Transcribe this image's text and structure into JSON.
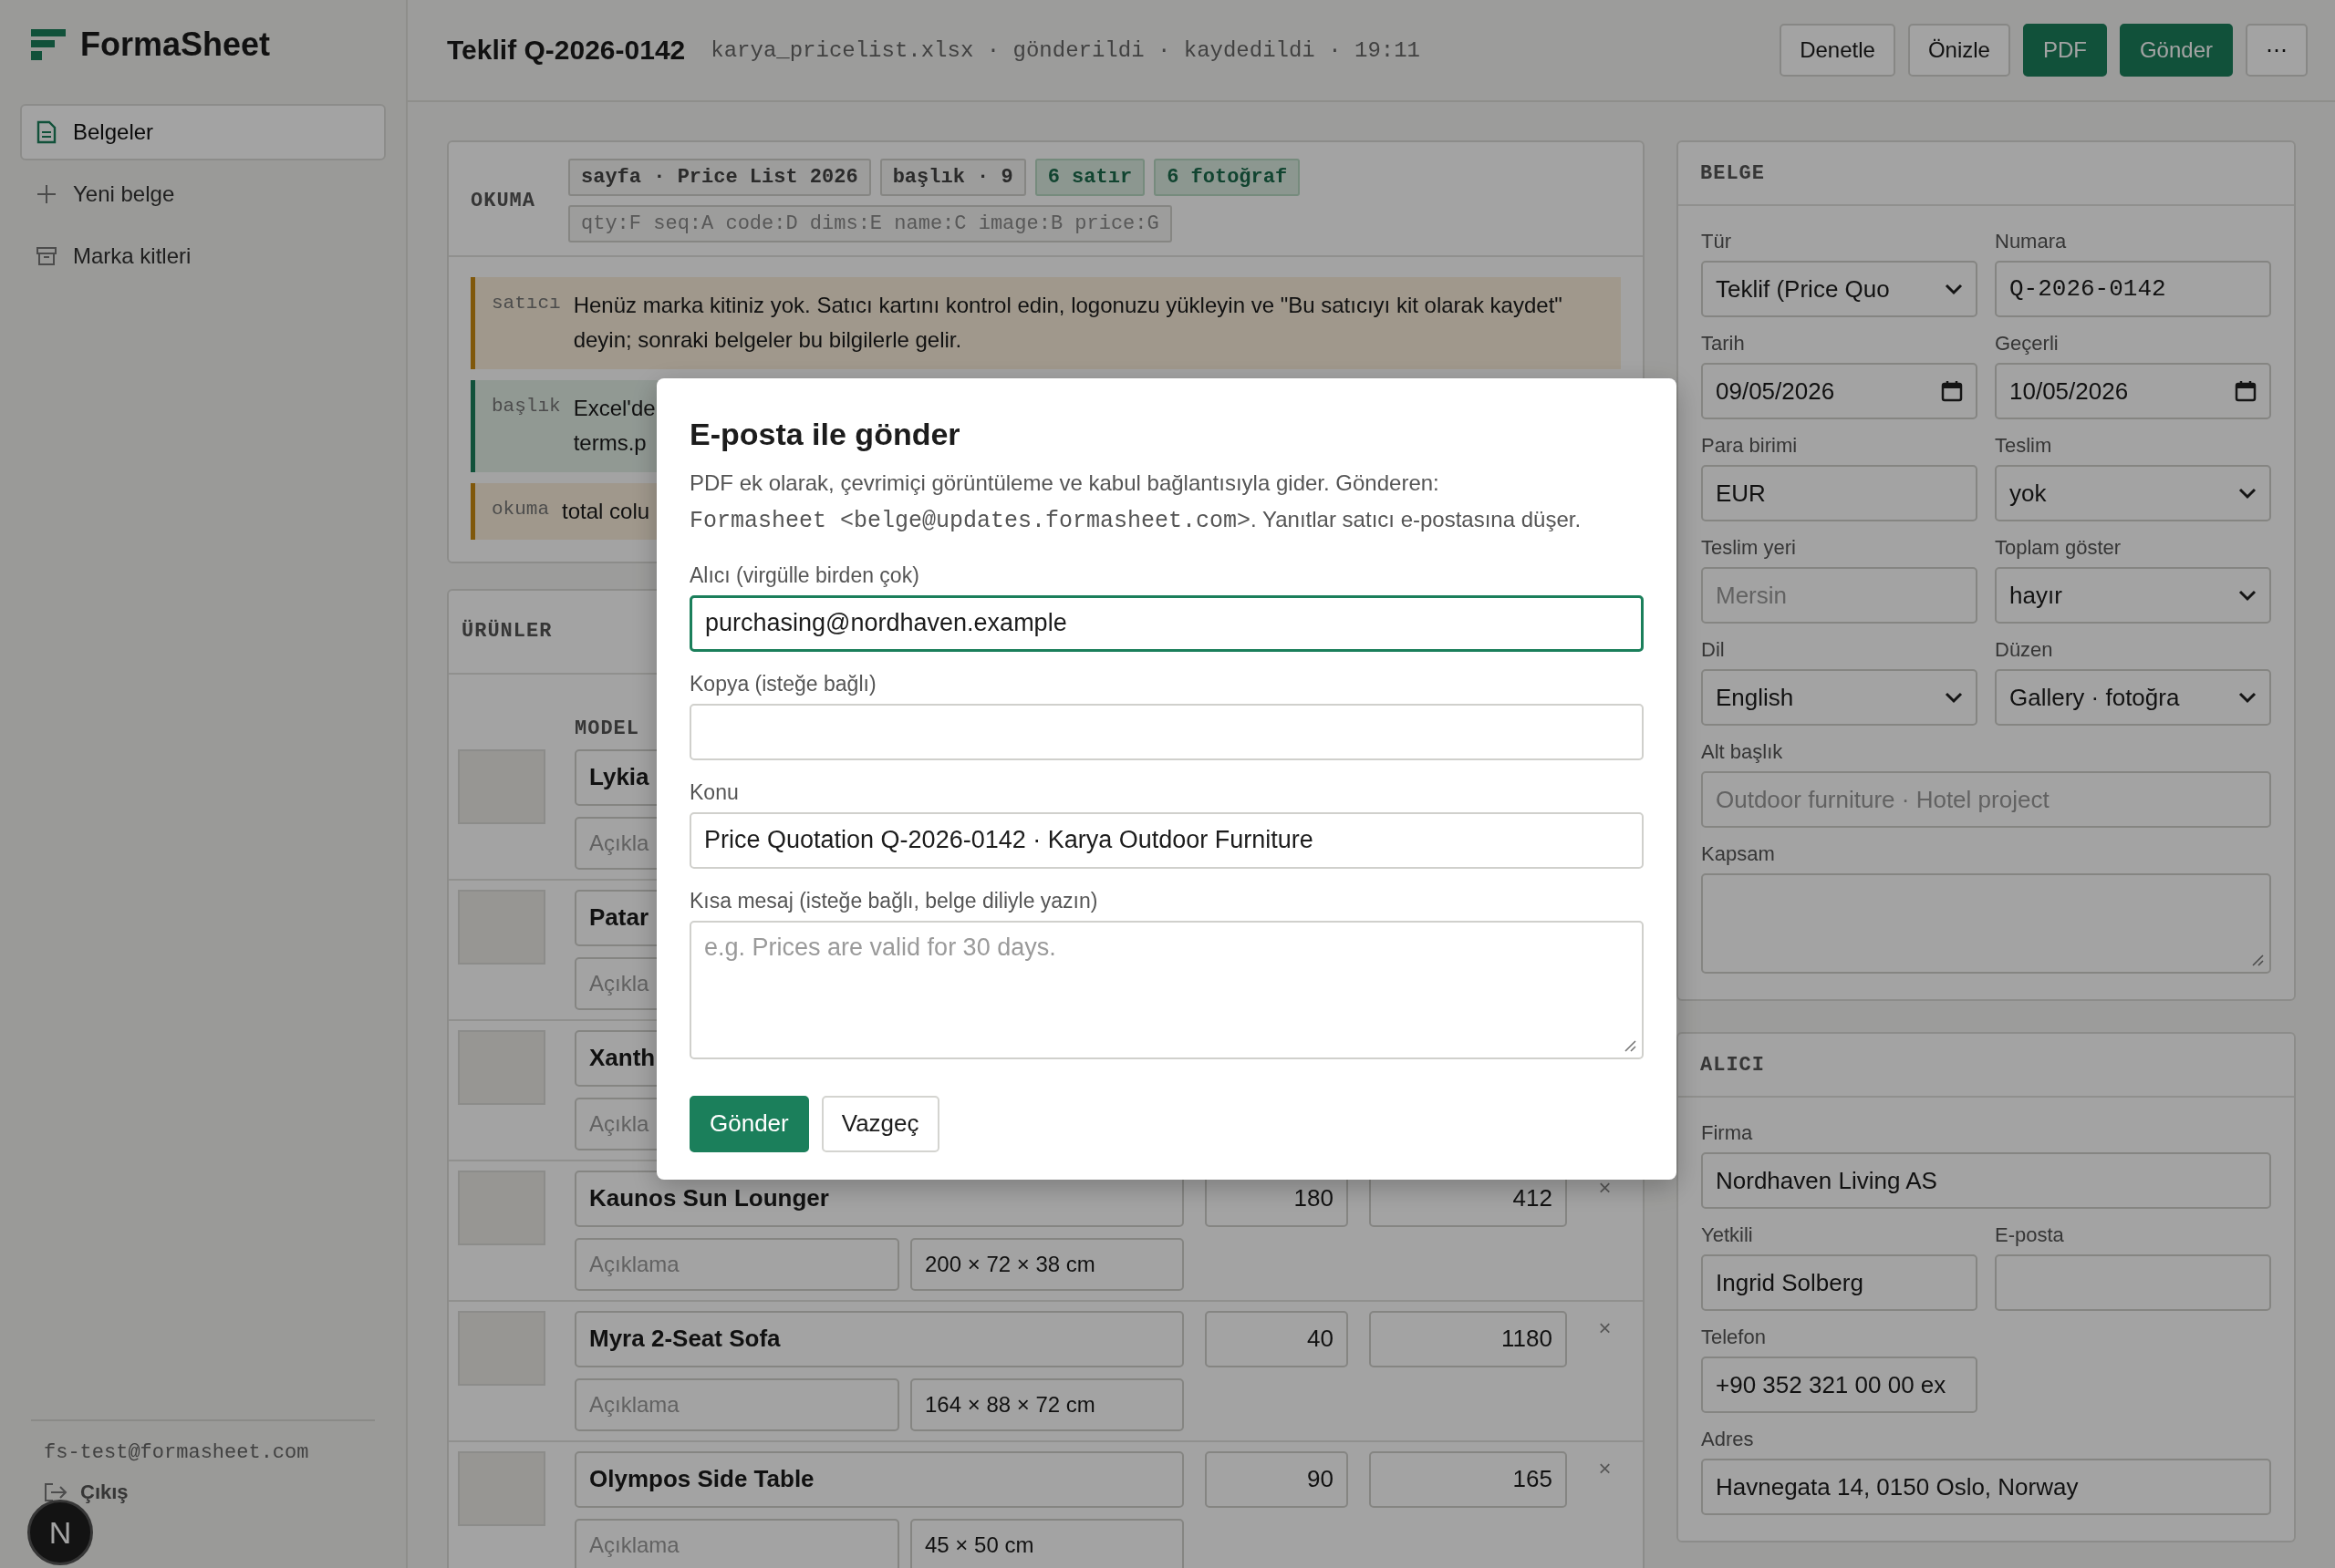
{
  "sidebar": {
    "brand": "FormaSheet",
    "items": [
      {
        "label": "Belgeler",
        "selected": true
      },
      {
        "label": "Yeni belge",
        "selected": false
      },
      {
        "label": "Marka kitleri",
        "selected": false
      }
    ],
    "user_email": "fs-test@formasheet.com",
    "logout": "Çıkış"
  },
  "header": {
    "title": "Teklif Q-2026-0142",
    "meta": "karya_pricelist.xlsx · gönderildi · kaydedildi · 19:11",
    "buttons": [
      {
        "label": "Denetle",
        "kind": "outline"
      },
      {
        "label": "Önizle",
        "kind": "outline"
      },
      {
        "label": "PDF",
        "kind": "primary"
      },
      {
        "label": "Gönder",
        "kind": "primary"
      },
      {
        "label": "⋯",
        "kind": "outline"
      }
    ]
  },
  "reading": {
    "title": "OKUMA",
    "chips": [
      {
        "label": "sayfa · Price List 2026",
        "kind": "plain"
      },
      {
        "label": "başlık · 9",
        "kind": "plain"
      },
      {
        "label": "6 satır",
        "kind": "success"
      },
      {
        "label": "6 fotoğraf",
        "kind": "success"
      }
    ],
    "mapping": "qty:F seq:A code:D dims:E name:C image:B price:G",
    "notes": [
      {
        "tag": "satıcı",
        "kind": "warning",
        "lines": [
          "Henüz marka kitiniz yok. Satıcı kartını kontrol edin, logonuzu yükleyin ve \"Bu satıcıyı kit olarak kaydet\" deyin; sonraki belgeler bu bilgilerle gelir."
        ]
      },
      {
        "tag": "başlık",
        "kind": "success",
        "lines": [
          "Excel'de",
          "terms.p"
        ]
      },
      {
        "tag": "okuma",
        "kind": "warning",
        "lines": [
          "total colu"
        ]
      }
    ]
  },
  "products": {
    "title": "ÜRÜNLER",
    "columns": [
      "MODEL"
    ],
    "rows": [
      {
        "name": "Lykia",
        "description_placeholder": "Açıkla"
      },
      {
        "name": "Patar",
        "description_placeholder": "Açıkla"
      },
      {
        "name": "Xanth",
        "description_placeholder": "Açıkla"
      },
      {
        "name": "Kaunos Sun Lounger",
        "qty": "180",
        "price": "412",
        "description_placeholder": "Açıklama",
        "dims": "200 × 72 × 38 cm",
        "remove": "×"
      },
      {
        "name": "Myra 2-Seat Sofa",
        "qty": "40",
        "price": "1180",
        "description_placeholder": "Açıklama",
        "dims": "164 × 88 × 72 cm",
        "remove": "×"
      },
      {
        "name": "Olympos Side Table",
        "qty": "90",
        "price": "165",
        "description_placeholder": "Açıklama",
        "dims": "45 × 50 cm",
        "remove": "×"
      }
    ]
  },
  "document": {
    "title": "BELGE",
    "fields": [
      {
        "label": "Tür",
        "kind": "select",
        "value": "Teklif (Price Quo"
      },
      {
        "label": "Numara",
        "kind": "code",
        "value": "Q-2026-0142"
      },
      {
        "label": "Tarih",
        "kind": "date",
        "value": "09/05/2026"
      },
      {
        "label": "Geçerli",
        "kind": "date",
        "value": "10/05/2026"
      },
      {
        "label": "Para birimi",
        "kind": "text",
        "value": "EUR"
      },
      {
        "label": "Teslim",
        "kind": "select",
        "value": "yok"
      },
      {
        "label": "Teslim yeri",
        "kind": "text",
        "placeholder": "Mersin"
      },
      {
        "label": "Toplam göster",
        "kind": "select",
        "value": "hayır"
      },
      {
        "label": "Dil",
        "kind": "select",
        "value": "English"
      },
      {
        "label": "Düzen",
        "kind": "select",
        "value": "Gallery · fotoğra"
      },
      {
        "label": "Alt başlık",
        "kind": "text-wide",
        "placeholder": "Outdoor furniture · Hotel project"
      },
      {
        "label": "Kapsam",
        "kind": "textarea"
      }
    ]
  },
  "recipient": {
    "title": "ALICI",
    "fields": [
      {
        "label": "Firma",
        "kind": "text-wide",
        "value": "Nordhaven Living AS"
      },
      {
        "label": "Yetkili",
        "kind": "text",
        "value": "Ingrid Solberg"
      },
      {
        "label": "E-posta",
        "kind": "text"
      },
      {
        "label": "Telefon",
        "kind": "text",
        "value": "+90 352 321 00 00 ex"
      },
      {
        "label": "Adres",
        "kind": "text-wide",
        "value": "Havnegata 14, 0150 Oslo, Norway"
      }
    ]
  },
  "email_dialog": {
    "title": "E-posta ile gönder",
    "description": "PDF ek olarak, çevrimiçi görüntüleme ve kabul bağlantısıyla gider. Gönderen:",
    "sender": "Formasheet <belge@updates.formasheet.com>",
    "reply_note": ". Yanıtlar satıcı e-postasına düşer.",
    "fields": [
      {
        "label": "Alıcı (virgülle birden çok)",
        "kind": "text",
        "value": "purchasing@nordhaven.example",
        "focused": true
      },
      {
        "label": "Kopya (isteğe bağlı)",
        "kind": "text",
        "focused": false
      },
      {
        "label": "Konu",
        "kind": "text",
        "value": "Price Quotation Q-2026-0142 · Karya Outdoor Furniture",
        "focused": false
      },
      {
        "label": "Kısa mesaj (isteğe bağlı, belge diliyle yazın)",
        "kind": "textarea",
        "placeholder": "e.g. Prices are valid for 30 days.",
        "focused": false
      }
    ],
    "buttons": [
      {
        "label": "Gönder",
        "kind": "primary"
      },
      {
        "label": "Vazgeç",
        "kind": "outline"
      }
    ]
  },
  "dev_badge": "N"
}
